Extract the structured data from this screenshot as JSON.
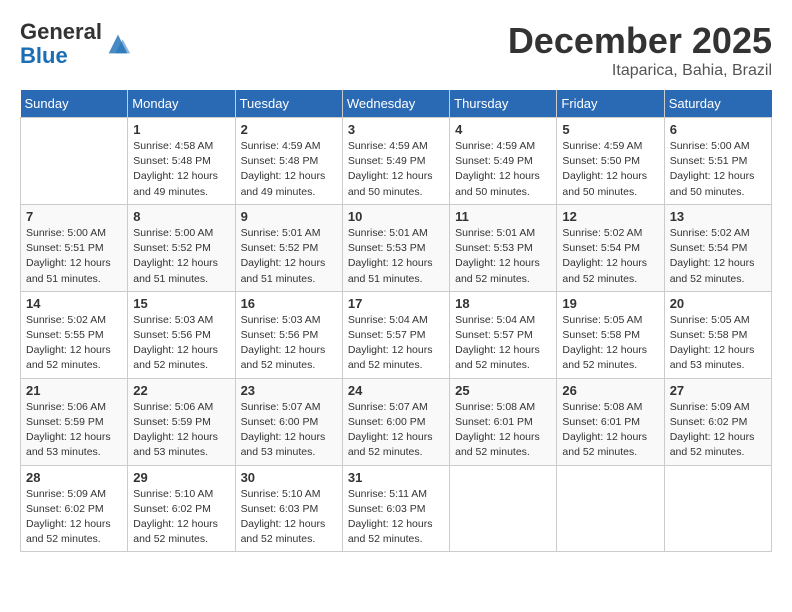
{
  "header": {
    "logo_general": "General",
    "logo_blue": "Blue",
    "month": "December 2025",
    "location": "Itaparica, Bahia, Brazil"
  },
  "days": [
    "Sunday",
    "Monday",
    "Tuesday",
    "Wednesday",
    "Thursday",
    "Friday",
    "Saturday"
  ],
  "weeks": [
    [
      {
        "num": "",
        "info": ""
      },
      {
        "num": "1",
        "info": "Sunrise: 4:58 AM\nSunset: 5:48 PM\nDaylight: 12 hours\nand 49 minutes."
      },
      {
        "num": "2",
        "info": "Sunrise: 4:59 AM\nSunset: 5:48 PM\nDaylight: 12 hours\nand 49 minutes."
      },
      {
        "num": "3",
        "info": "Sunrise: 4:59 AM\nSunset: 5:49 PM\nDaylight: 12 hours\nand 50 minutes."
      },
      {
        "num": "4",
        "info": "Sunrise: 4:59 AM\nSunset: 5:49 PM\nDaylight: 12 hours\nand 50 minutes."
      },
      {
        "num": "5",
        "info": "Sunrise: 4:59 AM\nSunset: 5:50 PM\nDaylight: 12 hours\nand 50 minutes."
      },
      {
        "num": "6",
        "info": "Sunrise: 5:00 AM\nSunset: 5:51 PM\nDaylight: 12 hours\nand 50 minutes."
      }
    ],
    [
      {
        "num": "7",
        "info": "Sunrise: 5:00 AM\nSunset: 5:51 PM\nDaylight: 12 hours\nand 51 minutes."
      },
      {
        "num": "8",
        "info": "Sunrise: 5:00 AM\nSunset: 5:52 PM\nDaylight: 12 hours\nand 51 minutes."
      },
      {
        "num": "9",
        "info": "Sunrise: 5:01 AM\nSunset: 5:52 PM\nDaylight: 12 hours\nand 51 minutes."
      },
      {
        "num": "10",
        "info": "Sunrise: 5:01 AM\nSunset: 5:53 PM\nDaylight: 12 hours\nand 51 minutes."
      },
      {
        "num": "11",
        "info": "Sunrise: 5:01 AM\nSunset: 5:53 PM\nDaylight: 12 hours\nand 52 minutes."
      },
      {
        "num": "12",
        "info": "Sunrise: 5:02 AM\nSunset: 5:54 PM\nDaylight: 12 hours\nand 52 minutes."
      },
      {
        "num": "13",
        "info": "Sunrise: 5:02 AM\nSunset: 5:54 PM\nDaylight: 12 hours\nand 52 minutes."
      }
    ],
    [
      {
        "num": "14",
        "info": "Sunrise: 5:02 AM\nSunset: 5:55 PM\nDaylight: 12 hours\nand 52 minutes."
      },
      {
        "num": "15",
        "info": "Sunrise: 5:03 AM\nSunset: 5:56 PM\nDaylight: 12 hours\nand 52 minutes."
      },
      {
        "num": "16",
        "info": "Sunrise: 5:03 AM\nSunset: 5:56 PM\nDaylight: 12 hours\nand 52 minutes."
      },
      {
        "num": "17",
        "info": "Sunrise: 5:04 AM\nSunset: 5:57 PM\nDaylight: 12 hours\nand 52 minutes."
      },
      {
        "num": "18",
        "info": "Sunrise: 5:04 AM\nSunset: 5:57 PM\nDaylight: 12 hours\nand 52 minutes."
      },
      {
        "num": "19",
        "info": "Sunrise: 5:05 AM\nSunset: 5:58 PM\nDaylight: 12 hours\nand 52 minutes."
      },
      {
        "num": "20",
        "info": "Sunrise: 5:05 AM\nSunset: 5:58 PM\nDaylight: 12 hours\nand 53 minutes."
      }
    ],
    [
      {
        "num": "21",
        "info": "Sunrise: 5:06 AM\nSunset: 5:59 PM\nDaylight: 12 hours\nand 53 minutes."
      },
      {
        "num": "22",
        "info": "Sunrise: 5:06 AM\nSunset: 5:59 PM\nDaylight: 12 hours\nand 53 minutes."
      },
      {
        "num": "23",
        "info": "Sunrise: 5:07 AM\nSunset: 6:00 PM\nDaylight: 12 hours\nand 53 minutes."
      },
      {
        "num": "24",
        "info": "Sunrise: 5:07 AM\nSunset: 6:00 PM\nDaylight: 12 hours\nand 52 minutes."
      },
      {
        "num": "25",
        "info": "Sunrise: 5:08 AM\nSunset: 6:01 PM\nDaylight: 12 hours\nand 52 minutes."
      },
      {
        "num": "26",
        "info": "Sunrise: 5:08 AM\nSunset: 6:01 PM\nDaylight: 12 hours\nand 52 minutes."
      },
      {
        "num": "27",
        "info": "Sunrise: 5:09 AM\nSunset: 6:02 PM\nDaylight: 12 hours\nand 52 minutes."
      }
    ],
    [
      {
        "num": "28",
        "info": "Sunrise: 5:09 AM\nSunset: 6:02 PM\nDaylight: 12 hours\nand 52 minutes."
      },
      {
        "num": "29",
        "info": "Sunrise: 5:10 AM\nSunset: 6:02 PM\nDaylight: 12 hours\nand 52 minutes."
      },
      {
        "num": "30",
        "info": "Sunrise: 5:10 AM\nSunset: 6:03 PM\nDaylight: 12 hours\nand 52 minutes."
      },
      {
        "num": "31",
        "info": "Sunrise: 5:11 AM\nSunset: 6:03 PM\nDaylight: 12 hours\nand 52 minutes."
      },
      {
        "num": "",
        "info": ""
      },
      {
        "num": "",
        "info": ""
      },
      {
        "num": "",
        "info": ""
      }
    ]
  ]
}
